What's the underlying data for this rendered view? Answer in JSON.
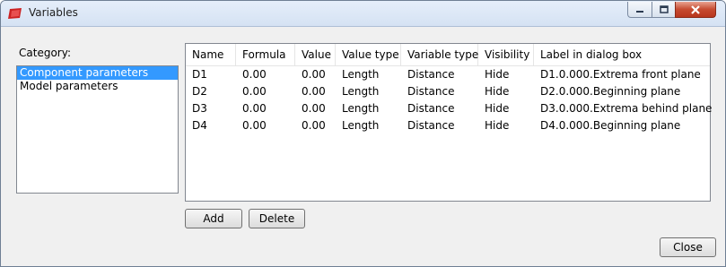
{
  "window": {
    "title": "Variables"
  },
  "category": {
    "label": "Category:",
    "items": [
      "Component parameters",
      "Model parameters"
    ],
    "selected_index": 0
  },
  "table": {
    "columns": [
      "Name",
      "Formula",
      "Value",
      "Value type",
      "Variable type",
      "Visibility",
      "Label in dialog box"
    ],
    "rows": [
      [
        "D1",
        "0.00",
        "0.00",
        "Length",
        "Distance",
        "Hide",
        "D1.0.000.Extrema front plane"
      ],
      [
        "D2",
        "0.00",
        "0.00",
        "Length",
        "Distance",
        "Hide",
        "D2.0.000.Beginning plane"
      ],
      [
        "D3",
        "0.00",
        "0.00",
        "Length",
        "Distance",
        "Hide",
        "D3.0.000.Extrema behind plane"
      ],
      [
        "D4",
        "0.00",
        "0.00",
        "Length",
        "Distance",
        "Hide",
        "D4.0.000.Beginning plane"
      ]
    ]
  },
  "buttons": {
    "add": "Add",
    "delete": "Delete",
    "close": "Close"
  },
  "colors": {
    "selection": "#3399ff",
    "close_button": "#c64a30",
    "app_icon": "#cc2222"
  }
}
